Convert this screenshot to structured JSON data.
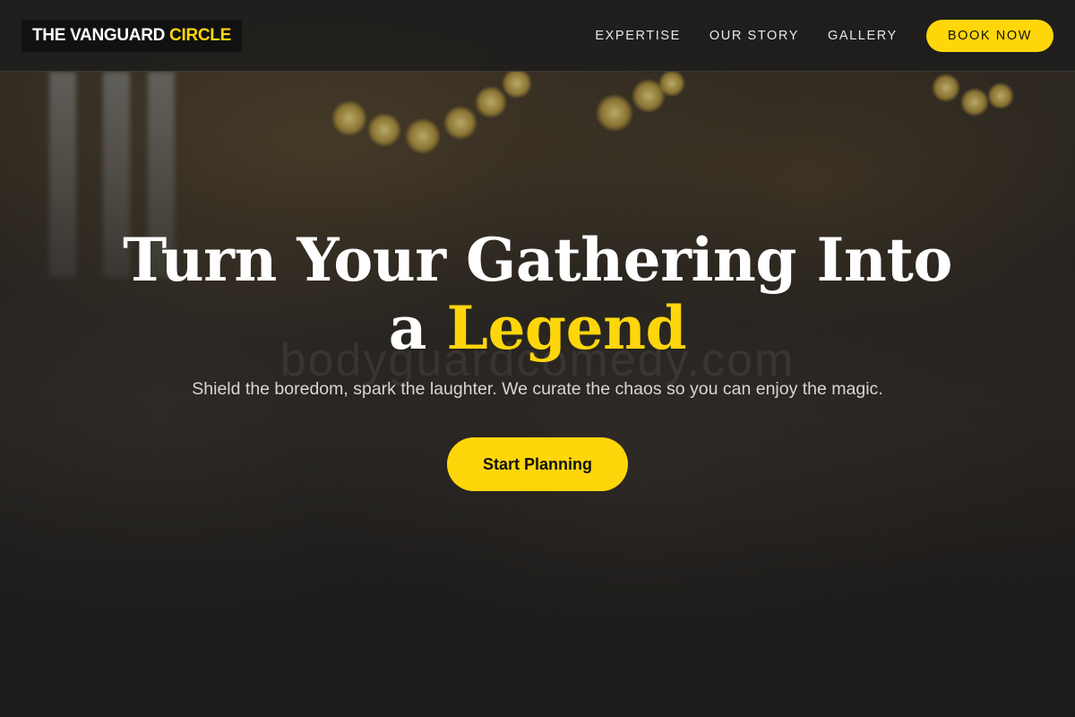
{
  "header": {
    "logo_main": "THE VANGUARD",
    "logo_accent": "CIRCLE",
    "nav": [
      {
        "label": "EXPERTISE"
      },
      {
        "label": "OUR STORY"
      },
      {
        "label": "GALLERY"
      }
    ],
    "book_label": "BOOK NOW"
  },
  "hero": {
    "headline_line1": "Turn Your Gathering Into",
    "headline_line2_prefix": "a",
    "headline_line2_accent": "Legend",
    "watermark": "bodyguardcomedy.com",
    "subtitle": "Shield the boredom, spark the laughter. We curate the chaos so you can enjoy the magic.",
    "cta_label": "Start Planning"
  },
  "colors": {
    "accent": "#ffd60a",
    "header_bg": "#1c1c1c",
    "text": "#ffffff"
  }
}
